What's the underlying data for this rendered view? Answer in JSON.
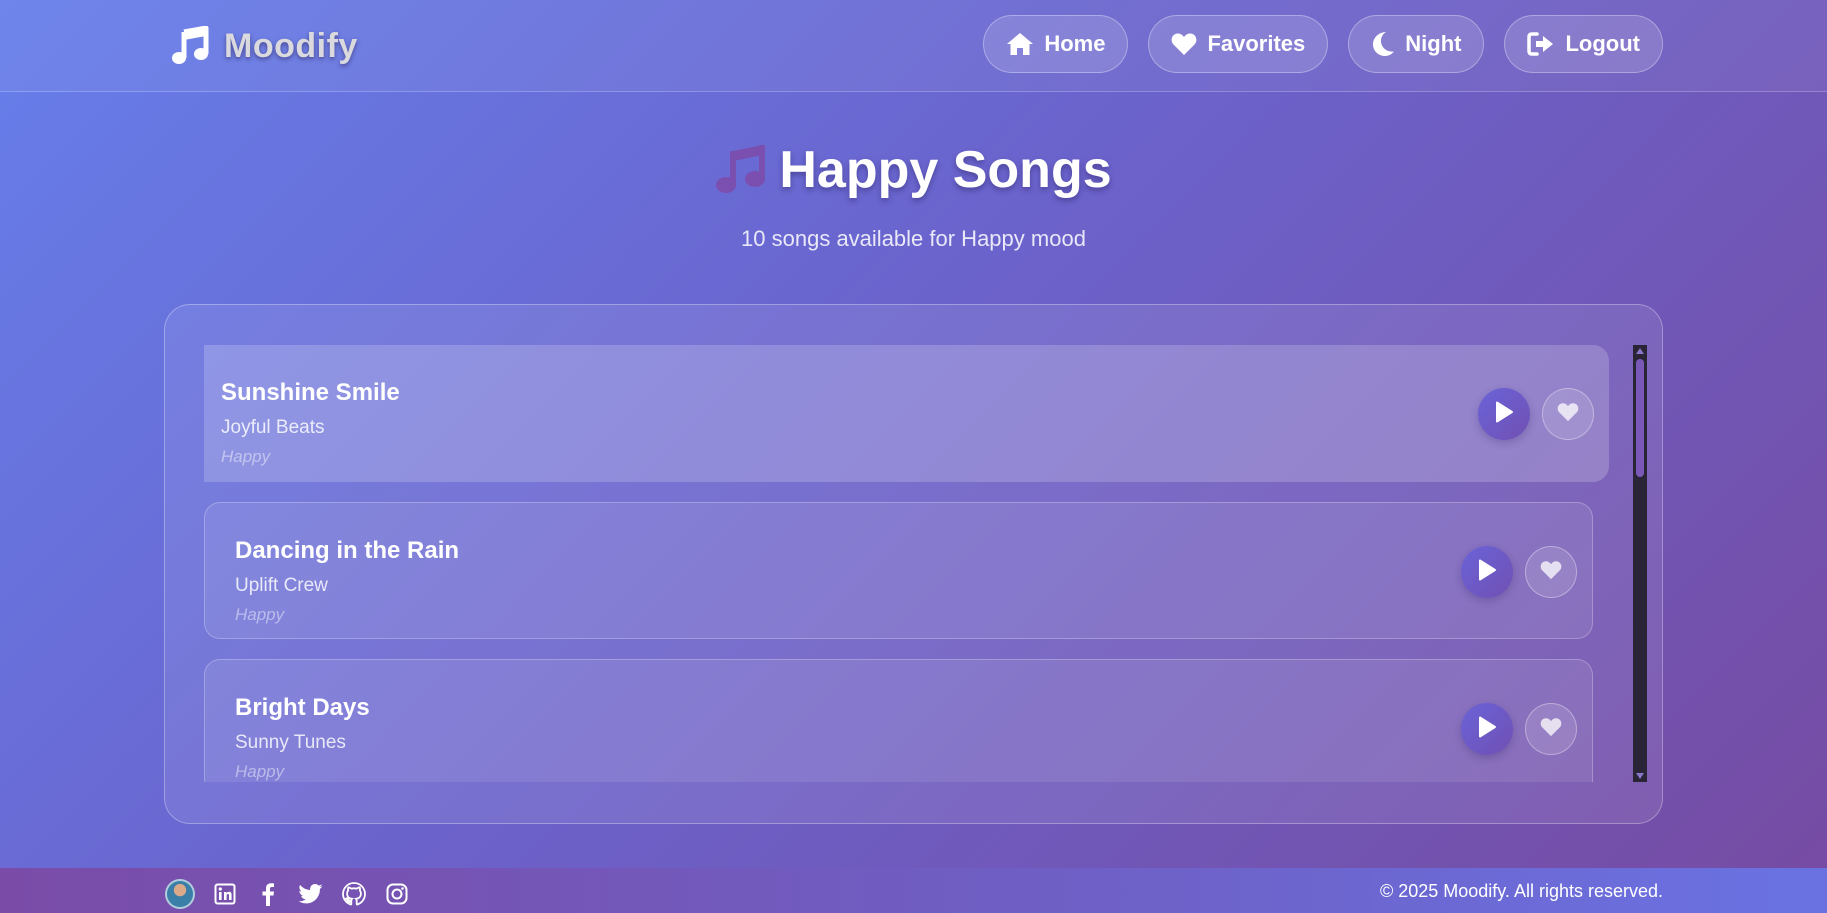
{
  "app": {
    "brand": "Moodify",
    "brand_icon": "music-note-icon"
  },
  "nav": {
    "items": [
      {
        "label": "Home",
        "icon": "home-icon"
      },
      {
        "label": "Favorites",
        "icon": "heart-icon"
      },
      {
        "label": "Night",
        "icon": "moon-icon"
      },
      {
        "label": "Logout",
        "icon": "logout-icon"
      }
    ]
  },
  "header": {
    "title": "Happy Songs",
    "title_icon": "music-note-icon",
    "subtitle": "10 songs available for Happy mood"
  },
  "songs": [
    {
      "title": "Sunshine Smile",
      "artist": "Joyful Beats",
      "mood": "Happy",
      "active": true
    },
    {
      "title": "Dancing in the Rain",
      "artist": "Uplift Crew",
      "mood": "Happy",
      "active": false
    },
    {
      "title": "Bright Days",
      "artist": "Sunny Tunes",
      "mood": "Happy",
      "active": false
    }
  ],
  "footer": {
    "social_icons": [
      "avatar",
      "linkedin-icon",
      "facebook-icon",
      "twitter-icon",
      "github-icon",
      "instagram-icon"
    ],
    "copyright": "© 2025 Moodify. All rights reserved."
  },
  "colors": {
    "gradient_start": "#667eea",
    "gradient_end": "#764ba2",
    "accent_purple": "#7150b3"
  }
}
